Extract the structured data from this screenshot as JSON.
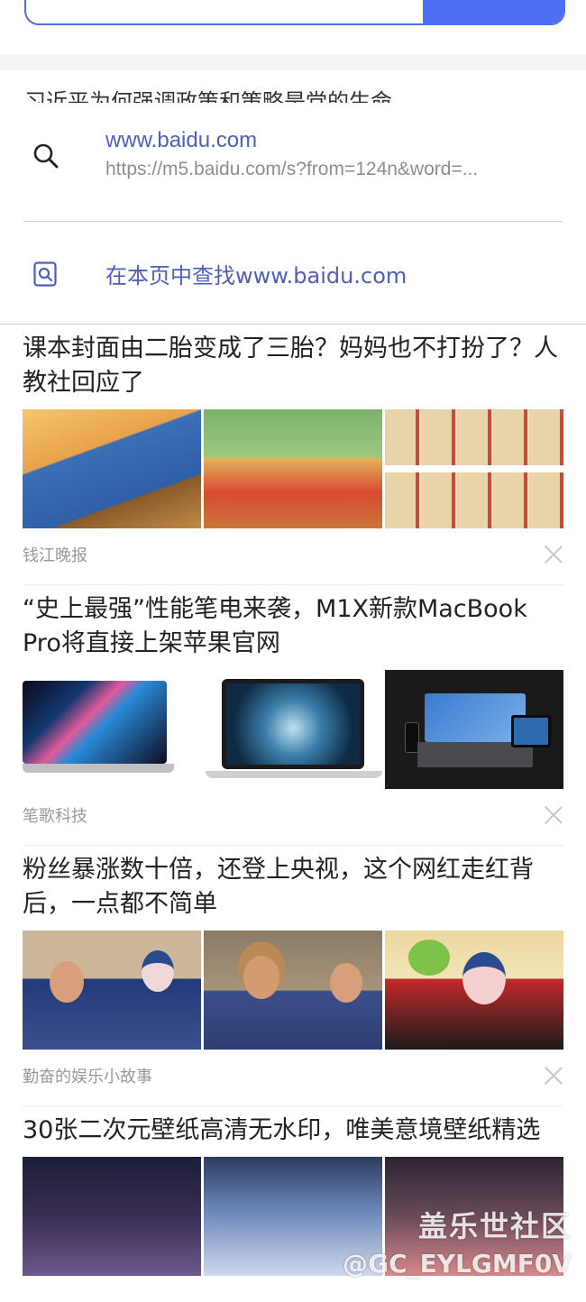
{
  "search": {
    "query": ""
  },
  "hot_line": "习近平为何强调政策和策略是党的生命",
  "suggestion": {
    "title": "www.baidu.com",
    "url": "https://m5.baidu.com/s?from=124n&word=...",
    "find_in_page": "在本页中查找www.baidu.com"
  },
  "feed": [
    {
      "title": "课本封面由二胎变成了三胎？妈妈也不打扮了？人教社回应了",
      "source": "钱江晚报",
      "images": [
        "children-drawing",
        "girls-drawing",
        "textbook-covers"
      ]
    },
    {
      "title": "“史上最强”性能笔电来袭，M1X新款MacBook Pro将直接上架苹果官网",
      "source": "笔歌科技",
      "images": [
        "macbook-side",
        "macbook-front",
        "macbook-devices"
      ]
    },
    {
      "title": "粉丝暴涨数十倍，还登上央视，这个网红走红背后，一点都不简单",
      "source": "勤奋的娱乐小故事",
      "images": [
        "police-and-opera",
        "straw-hat-man",
        "opera-makeup"
      ]
    },
    {
      "title": "30张二次元壁纸高清无水印，唯美意境壁纸精选",
      "source": "",
      "images": [
        "anime-girl",
        "anime-scene",
        "anime-portrait"
      ]
    }
  ],
  "watermark": {
    "line1": "盖乐世社区",
    "line2": "@GC_EYLGMF0V"
  },
  "colors": {
    "accent": "#4e6ef2",
    "link": "#4e5fb8",
    "source": "#999999"
  }
}
